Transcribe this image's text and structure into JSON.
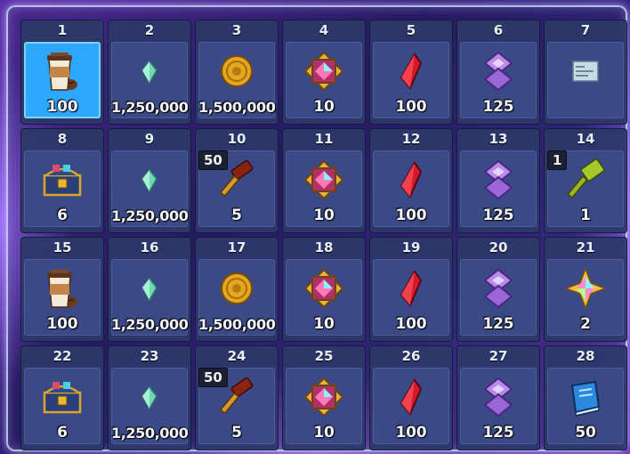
{
  "cells": [
    {
      "n": "1",
      "qty": "100",
      "icon": "coffee-cup-icon",
      "selected": true
    },
    {
      "n": "2",
      "qty": "1,250,000",
      "icon": "green-crystal-icon"
    },
    {
      "n": "3",
      "qty": "1,500,000",
      "icon": "gold-coin-icon"
    },
    {
      "n": "4",
      "qty": "10",
      "icon": "rainbow-gem-frame-icon"
    },
    {
      "n": "5",
      "qty": "100",
      "icon": "red-crystal-icon"
    },
    {
      "n": "6",
      "qty": "125",
      "icon": "purple-rune-icon"
    },
    {
      "n": "7",
      "qty": "",
      "icon": "scroll-map-icon"
    },
    {
      "n": "8",
      "qty": "6",
      "icon": "treasure-chest-icon"
    },
    {
      "n": "9",
      "qty": "1,250,000",
      "icon": "green-crystal-icon"
    },
    {
      "n": "10",
      "qty": "5",
      "icon": "hammer-icon",
      "tag": "50"
    },
    {
      "n": "11",
      "qty": "10",
      "icon": "rainbow-gem-frame-icon"
    },
    {
      "n": "12",
      "qty": "100",
      "icon": "red-crystal-icon"
    },
    {
      "n": "13",
      "qty": "125",
      "icon": "purple-rune-icon"
    },
    {
      "n": "14",
      "qty": "1",
      "icon": "green-hammer-icon",
      "tag": "1"
    },
    {
      "n": "15",
      "qty": "100",
      "icon": "coffee-cup-icon"
    },
    {
      "n": "16",
      "qty": "1,250,000",
      "icon": "green-crystal-icon"
    },
    {
      "n": "17",
      "qty": "1,500,000",
      "icon": "gold-coin-icon"
    },
    {
      "n": "18",
      "qty": "10",
      "icon": "rainbow-gem-frame-icon"
    },
    {
      "n": "19",
      "qty": "100",
      "icon": "red-crystal-icon"
    },
    {
      "n": "20",
      "qty": "125",
      "icon": "purple-rune-icon"
    },
    {
      "n": "21",
      "qty": "2",
      "icon": "rainbow-star-gem-icon"
    },
    {
      "n": "22",
      "qty": "6",
      "icon": "treasure-chest-icon"
    },
    {
      "n": "23",
      "qty": "1,250,000",
      "icon": "green-crystal-icon"
    },
    {
      "n": "24",
      "qty": "5",
      "icon": "hammer-icon",
      "tag": "50"
    },
    {
      "n": "25",
      "qty": "10",
      "icon": "rainbow-gem-frame-icon"
    },
    {
      "n": "26",
      "qty": "100",
      "icon": "red-crystal-icon"
    },
    {
      "n": "27",
      "qty": "125",
      "icon": "purple-rune-icon"
    },
    {
      "n": "28",
      "qty": "50",
      "icon": "blue-book-icon"
    }
  ],
  "colors": {
    "cell_bg": "#2c3868",
    "slot_bg": "#3b4a86",
    "selected_slot": "#2ea8ff",
    "panel_border": "#c8dcff"
  }
}
